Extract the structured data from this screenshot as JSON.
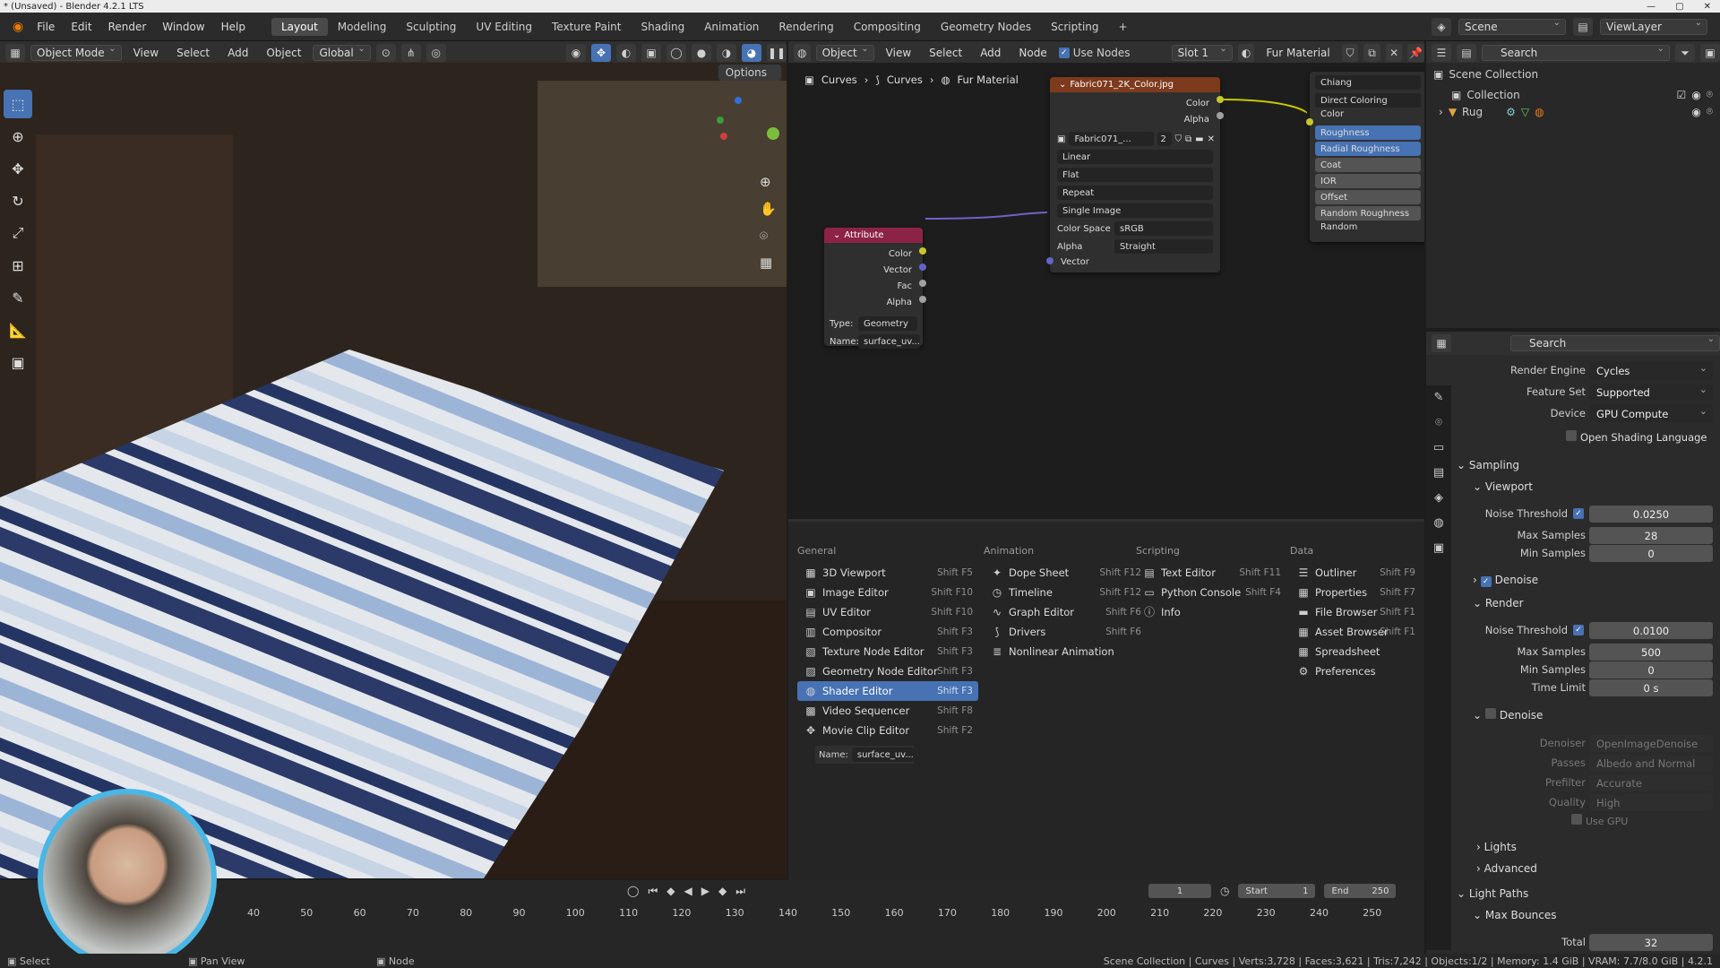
{
  "titlebar": {
    "title": "* (Unsaved) - Blender 4.2.1 LTS"
  },
  "menu": [
    "File",
    "Edit",
    "Render",
    "Window",
    "Help"
  ],
  "workspaces": [
    {
      "label": "Layout",
      "active": true
    },
    {
      "label": "Modeling"
    },
    {
      "label": "Sculpting"
    },
    {
      "label": "UV Editing"
    },
    {
      "label": "Texture Paint"
    },
    {
      "label": "Shading"
    },
    {
      "label": "Animation"
    },
    {
      "label": "Rendering"
    },
    {
      "label": "Compositing"
    },
    {
      "label": "Geometry Nodes"
    },
    {
      "label": "Scripting"
    }
  ],
  "topright": {
    "scene": "Scene",
    "viewlayer": "ViewLayer"
  },
  "viewport_header": {
    "mode": "Object Mode",
    "view": "View",
    "select": "Select",
    "add": "Add",
    "object": "Object",
    "transform": "Global",
    "options": "Options"
  },
  "node_header": {
    "object": "Object",
    "view": "View",
    "select": "Select",
    "add": "Add",
    "node": "Node",
    "use_nodes": "Use Nodes",
    "slot": "Slot 1",
    "material": "Fur Material"
  },
  "breadcrumb": [
    "Curves",
    "Curves",
    "Fur Material"
  ],
  "nodes": {
    "attribute": {
      "title": "Attribute",
      "outputs": [
        "Color",
        "Vector",
        "Fac",
        "Alpha"
      ],
      "type_label": "Type:",
      "type_value": "Geometry",
      "name_label": "Name:",
      "name_value": "surface_uv..."
    },
    "image": {
      "title": "Fabric071_2K_Color.jpg",
      "outputs": [
        "Color",
        "Alpha"
      ],
      "image_name": "Fabric071_...",
      "users": "2",
      "interp": "Linear",
      "proj": "Flat",
      "ext": "Repeat",
      "source": "Single Image",
      "cs_label": "Color Space",
      "cs_value": "sRGB",
      "alpha_label": "Alpha",
      "alpha_value": "Straight",
      "input": "Vector"
    },
    "hair": {
      "model": "Chiang",
      "param": "Direct Coloring",
      "inputs": [
        "Color",
        "Roughness",
        "Radial Roughness",
        "Coat",
        "IOR",
        "Offset",
        "Random Roughness",
        "Random"
      ]
    }
  },
  "editor_menu": {
    "general": {
      "title": "General",
      "items": [
        {
          "label": "3D Viewport",
          "sc": "Shift F5",
          "icon": "▦"
        },
        {
          "label": "Image Editor",
          "sc": "Shift F10",
          "icon": "▣"
        },
        {
          "label": "UV Editor",
          "sc": "Shift F10",
          "icon": "▤"
        },
        {
          "label": "Compositor",
          "sc": "Shift F3",
          "icon": "▥"
        },
        {
          "label": "Texture Node Editor",
          "sc": "Shift F3",
          "icon": "▧"
        },
        {
          "label": "Geometry Node Editor",
          "sc": "Shift F3",
          "icon": "▨"
        },
        {
          "label": "Shader Editor",
          "sc": "Shift F3",
          "icon": "◍"
        },
        {
          "label": "Video Sequencer",
          "sc": "Shift F8",
          "icon": "▩"
        },
        {
          "label": "Movie Clip Editor",
          "sc": "Shift F2",
          "icon": "✥"
        }
      ]
    },
    "animation": {
      "title": "Animation",
      "items": [
        {
          "label": "Dope Sheet",
          "sc": "Shift F12",
          "icon": "✦"
        },
        {
          "label": "Timeline",
          "sc": "Shift F12",
          "icon": "◷"
        },
        {
          "label": "Graph Editor",
          "sc": "Shift F6",
          "icon": "∿"
        },
        {
          "label": "Drivers",
          "sc": "Shift F6",
          "icon": "⟆"
        },
        {
          "label": "Nonlinear Animation",
          "sc": "",
          "icon": "≣"
        }
      ]
    },
    "scripting": {
      "title": "Scripting",
      "items": [
        {
          "label": "Text Editor",
          "sc": "Shift F11",
          "icon": "▤"
        },
        {
          "label": "Python Console",
          "sc": "Shift F4",
          "icon": "▭"
        },
        {
          "label": "Info",
          "sc": "",
          "icon": "ⓘ"
        }
      ]
    },
    "data": {
      "title": "Data",
      "items": [
        {
          "label": "Outliner",
          "sc": "Shift F9",
          "icon": "☰"
        },
        {
          "label": "Properties",
          "sc": "Shift F7",
          "icon": "▦"
        },
        {
          "label": "File Browser",
          "sc": "Shift F1",
          "icon": "▬"
        },
        {
          "label": "Asset Browser",
          "sc": "Shift F1",
          "icon": "▦"
        },
        {
          "label": "Spreadsheet",
          "sc": "",
          "icon": "▦"
        },
        {
          "label": "Preferences",
          "sc": "",
          "icon": "⚙"
        }
      ]
    },
    "name_label": "Name:",
    "name_value": "surface_uv..."
  },
  "outliner": {
    "search": "Search",
    "root": "Scene Collection",
    "collection": "Collection",
    "object": "Rug"
  },
  "properties": {
    "search": "Search",
    "render_engine": {
      "label": "Render Engine",
      "value": "Cycles"
    },
    "feature_set": {
      "label": "Feature Set",
      "value": "Supported"
    },
    "device": {
      "label": "Device",
      "value": "GPU Compute"
    },
    "osl": "Open Shading Language",
    "sampling": "Sampling",
    "viewport": "Viewport",
    "vp_noise": {
      "label": "Noise Threshold",
      "value": "0.0250"
    },
    "vp_max": {
      "label": "Max Samples",
      "value": "28"
    },
    "vp_min": {
      "label": "Min Samples",
      "value": "0"
    },
    "vp_denoise": "Denoise",
    "render": "Render",
    "r_noise": {
      "label": "Noise Threshold",
      "value": "0.0100"
    },
    "r_max": {
      "label": "Max Samples",
      "value": "500"
    },
    "r_min": {
      "label": "Min Samples",
      "value": "0"
    },
    "r_time": {
      "label": "Time Limit",
      "value": "0 s"
    },
    "r_denoise": "Denoise",
    "denoiser": {
      "label": "Denoiser",
      "value": "OpenImageDenoise"
    },
    "passes": {
      "label": "Passes",
      "value": "Albedo and Normal"
    },
    "prefilter": {
      "label": "Prefilter",
      "value": "Accurate"
    },
    "quality": {
      "label": "Quality",
      "value": "High"
    },
    "use_gpu": "Use GPU",
    "lights": "Lights",
    "advanced": "Advanced",
    "light_paths": "Light Paths",
    "max_bounces": "Max Bounces",
    "total": {
      "label": "Total",
      "value": "32"
    }
  },
  "timeline": {
    "frame": "1",
    "start_label": "Start",
    "start": "1",
    "end_label": "End",
    "end": "250",
    "ticks": [
      "40",
      "50",
      "60",
      "70",
      "80",
      "90",
      "100",
      "110",
      "120",
      "130",
      "140",
      "150",
      "160",
      "170",
      "180",
      "190",
      "200",
      "210",
      "220",
      "230",
      "240",
      "250"
    ]
  },
  "status": {
    "left": "Select",
    "mid": "Pan View",
    "right": "Node",
    "stats": "Scene Collection | Curves | Verts:3,728 | Faces:3,621 | Tris:7,242 | Objects:1/2 | Memory: 1.4 GiB | VRAM: 7.7/8.0 GiB | 4.2.1"
  },
  "colors": {
    "accent": "#4772b3",
    "attribute_header": "#8c2347",
    "image_header": "#7d3a1d",
    "yellow_link": "#c8c800",
    "purple_link": "#6f62c7"
  }
}
